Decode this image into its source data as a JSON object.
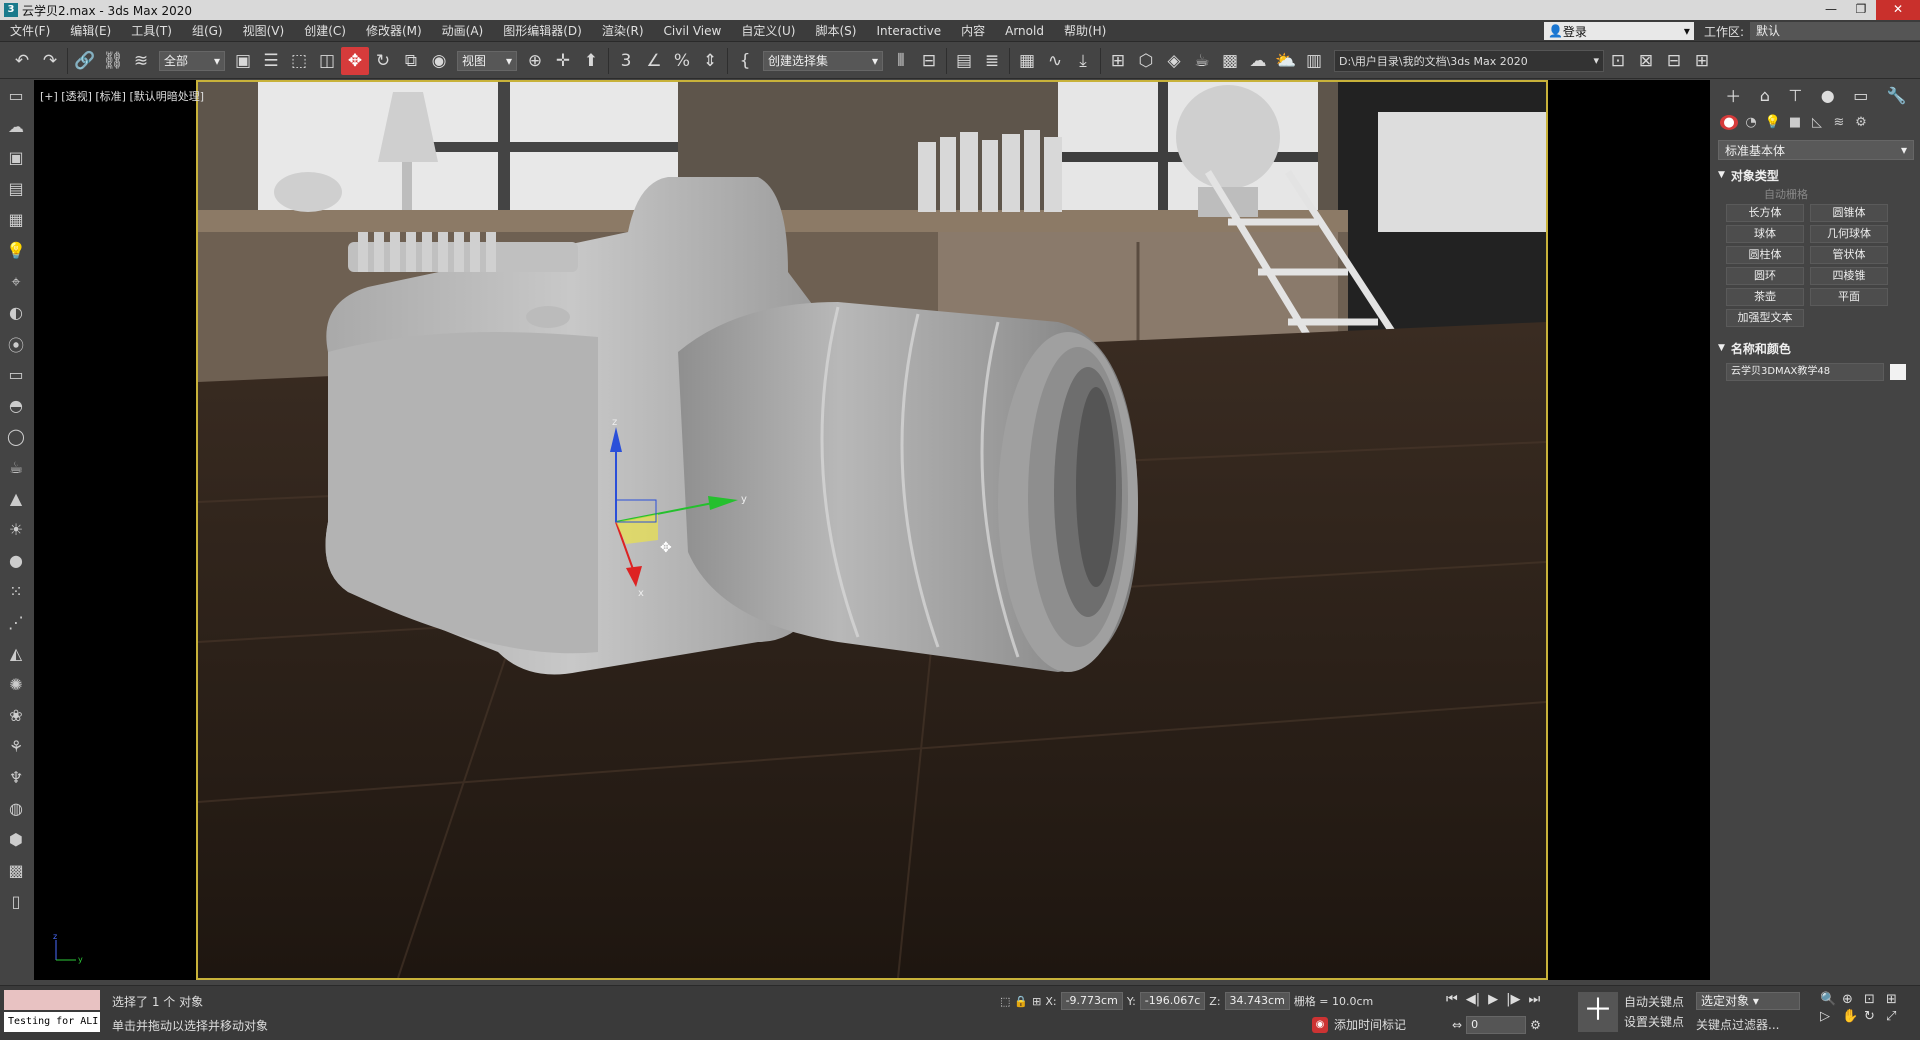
{
  "title": "云学贝2.max - 3ds Max 2020",
  "menus": [
    "文件(F)",
    "编辑(E)",
    "工具(T)",
    "组(G)",
    "视图(V)",
    "创建(C)",
    "修改器(M)",
    "动画(A)",
    "图形编辑器(D)",
    "渲染(R)",
    "Civil View",
    "自定义(U)",
    "脚本(S)",
    "Interactive",
    "内容",
    "Arnold",
    "帮助(H)"
  ],
  "login": "登录",
  "workspace_label": "工作区:",
  "workspace_value": "默认",
  "toolbar": {
    "filter_select": "全部",
    "ref_coord": "视图",
    "selection_set": "创建选择集",
    "project_path": "D:\\用户目录\\我的文档\\3ds Max 2020"
  },
  "viewport_label": "[+] [透视] [标准] [默认明暗处理]",
  "gizmo": {
    "x": "x",
    "y": "y",
    "z": "z"
  },
  "cmd_panel": {
    "category": "标准基本体",
    "object_type_header": "对象类型",
    "autogrid": "自动栅格",
    "buttons": [
      "长方体",
      "圆锥体",
      "球体",
      "几何球体",
      "圆柱体",
      "管状体",
      "圆环",
      "四棱锥",
      "茶壶",
      "平面"
    ],
    "extra_button": "加强型文本",
    "name_color_header": "名称和颜色",
    "object_name": "云学贝3DMAX教学48",
    "object_color": "#f2f2f2"
  },
  "status": {
    "testing": "Testing for ALI",
    "line1": "选择了 1 个 对象",
    "line2": "单击并拖动以选择并移动对象",
    "x_label": "X:",
    "x": "-9.773cm",
    "y_label": "Y:",
    "y": "-196.067c",
    "z_label": "Z:",
    "z": "34.743cm",
    "grid": "栅格 = 10.0cm",
    "add_time_tag": "添加时间标记",
    "frame": "0",
    "auto_key": "自动关键点",
    "set_key": "设置关键点",
    "key_selection": "选定对象",
    "key_filters": "关键点过滤器..."
  },
  "colors": {
    "accent": "#d63b3b",
    "viewport_border": "#c8b23a"
  }
}
